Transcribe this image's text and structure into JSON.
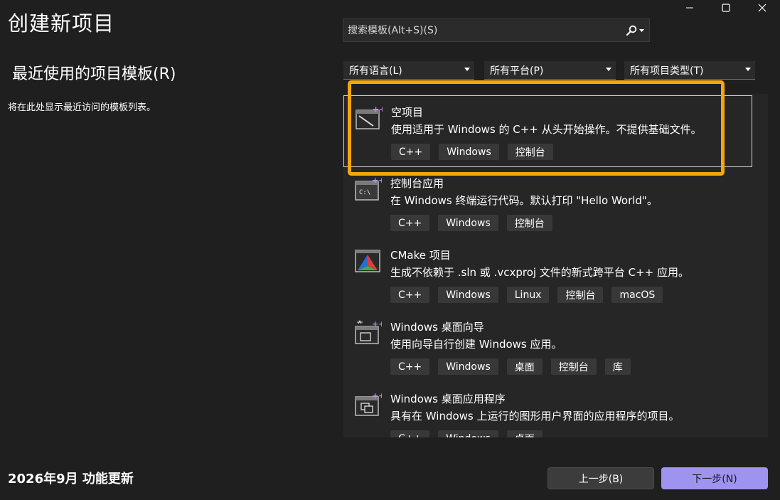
{
  "window": {
    "title": "创建新项目"
  },
  "left": {
    "recent_heading": "最近使用的项目模板(R)",
    "recent_empty": "将在此处显示最近访问的模板列表。"
  },
  "search": {
    "placeholder": "搜索模板(Alt+S)(S)"
  },
  "filters": {
    "language": "所有语言(L)",
    "platform": "所有平台(P)",
    "project_type": "所有项目类型(T)"
  },
  "templates": [
    {
      "icon": "empty-project-icon",
      "title": "空项目",
      "description": "使用适用于 Windows 的 C++ 从头开始操作。不提供基础文件。",
      "tags": [
        "C++",
        "Windows",
        "控制台"
      ],
      "selected": true
    },
    {
      "icon": "console-app-icon",
      "title": "控制台应用",
      "description": "在 Windows 终端运行代码。默认打印 \"Hello World\"。",
      "tags": [
        "C++",
        "Windows",
        "控制台"
      ]
    },
    {
      "icon": "cmake-icon",
      "title": "CMake 项目",
      "description": "生成不依赖于 .sln 或 .vcxproj 文件的新式跨平台 C++ 应用。",
      "tags": [
        "C++",
        "Windows",
        "Linux",
        "控制台",
        "macOS"
      ]
    },
    {
      "icon": "desktop-wizard-icon",
      "title": "Windows 桌面向导",
      "description": "使用向导自行创建 Windows 应用。",
      "tags": [
        "C++",
        "Windows",
        "桌面",
        "控制台",
        "库"
      ]
    },
    {
      "icon": "desktop-app-icon",
      "title": "Windows 桌面应用程序",
      "description": "具有在 Windows 上运行的图形用户界面的应用程序的项目。",
      "tags": [
        "C++",
        "Windows",
        "桌面"
      ]
    }
  ],
  "footer": {
    "update_text": "2026年9月 功能更新",
    "back_label": "上一步(B)",
    "next_label": "下一步(N)"
  },
  "colors": {
    "background": "#1f1f1f",
    "list_background": "#262626",
    "highlight": "#f5a70a",
    "primary_button": "#9f93f0"
  }
}
